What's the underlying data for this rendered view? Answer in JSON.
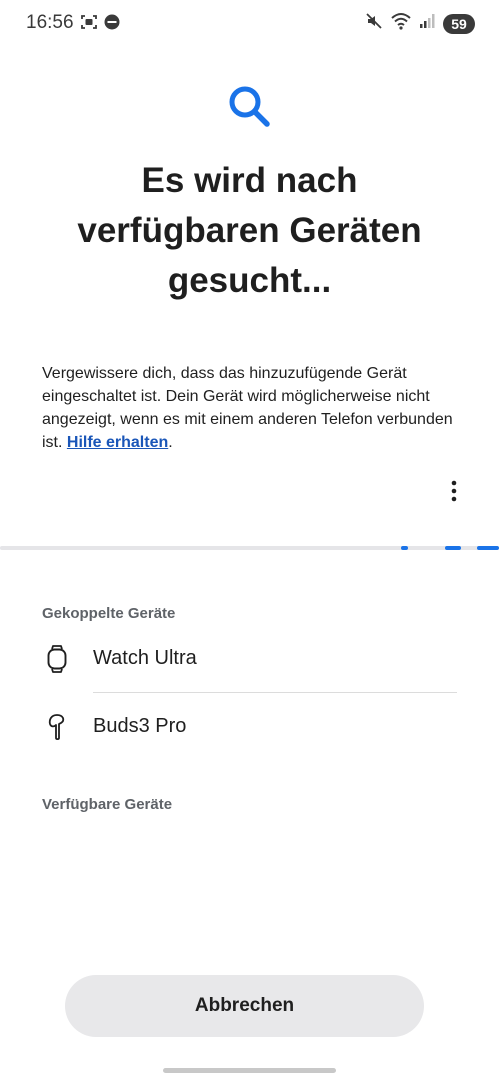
{
  "status_bar": {
    "time": "16:56",
    "battery": "59",
    "left_icons": [
      "screenshot-icon",
      "wear-icon"
    ],
    "right_icons": [
      "mute-icon",
      "wifi-icon",
      "signal-icon"
    ]
  },
  "header": {
    "icon": "search-icon",
    "title": "Es wird nach verfügbaren Geräten gesucht..."
  },
  "description": {
    "text": "Vergewissere dich, dass das hinzuzufügende Gerät eingeschaltet ist. Dein Gerät wird möglicherweise nicht angezeigt, wenn es mit einem anderen Telefon verbunden ist. ",
    "link": "Hilfe erhalten",
    "suffix": "."
  },
  "paired_section": {
    "label": "Gekoppelte Geräte",
    "devices": [
      {
        "name": "Watch Ultra",
        "icon": "watch-icon"
      },
      {
        "name": "Buds3 Pro",
        "icon": "earbud-icon"
      }
    ]
  },
  "available_section": {
    "label": "Verfügbare Geräte"
  },
  "footer": {
    "cancel_label": "Abbrechen"
  },
  "colors": {
    "accent": "#1a73e8",
    "link": "#1a56b8",
    "button_bg": "#e8e8ea"
  }
}
